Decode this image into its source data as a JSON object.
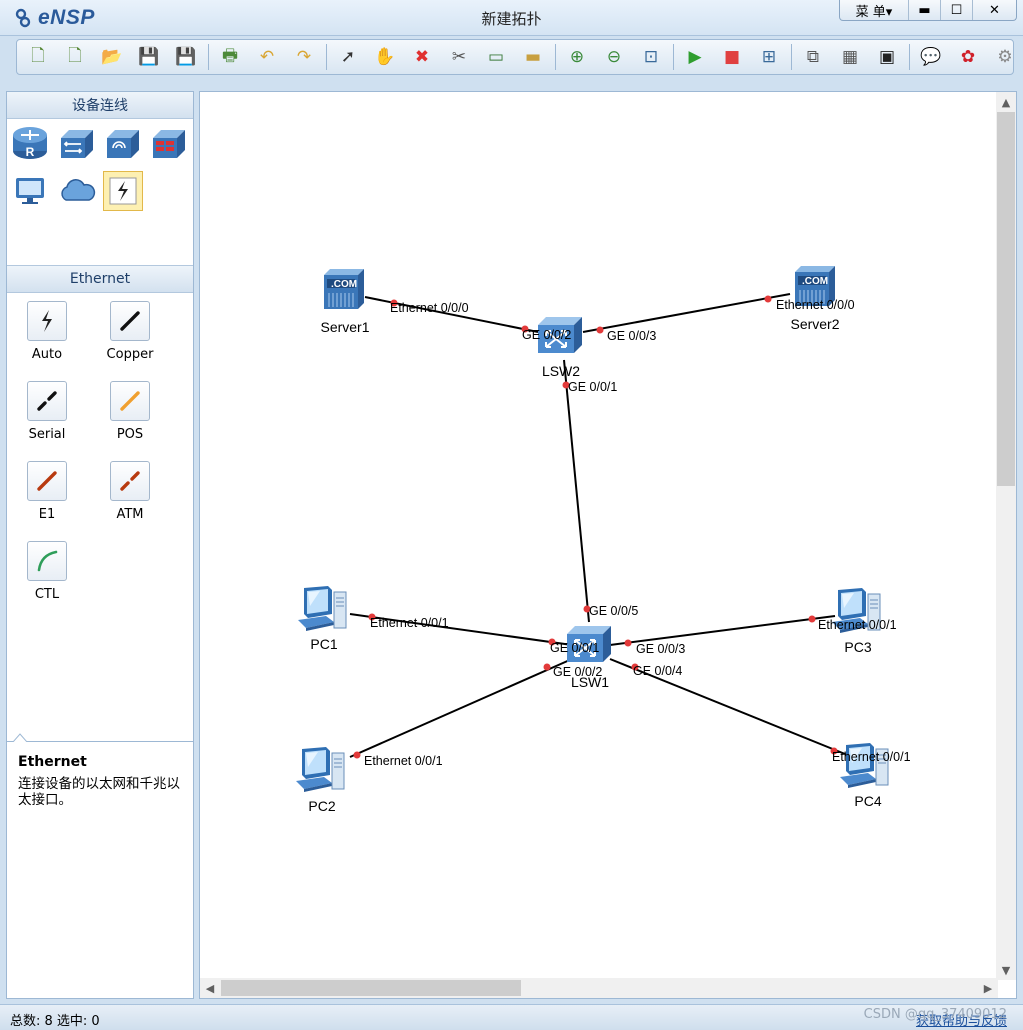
{
  "app": {
    "logo_text": "eNSP",
    "window_title": "新建拓扑",
    "menu_label": "菜 单▾",
    "minimize_glyph": "▬",
    "maximize_glyph": "☐",
    "close_glyph": "✕"
  },
  "toolbar": {
    "buttons": [
      {
        "name": "new-topology",
        "glyph": "🗋",
        "color": "#5a8a3a"
      },
      {
        "name": "new-lab",
        "glyph": "🗋",
        "color": "#5a8a3a"
      },
      {
        "name": "open",
        "glyph": "📂",
        "color": "#d9a633"
      },
      {
        "name": "save",
        "glyph": "💾",
        "color": "#c84040"
      },
      {
        "name": "save-as",
        "glyph": "💾",
        "color": "#c84040"
      },
      {
        "name": "print",
        "glyph": "🖶",
        "color": "#4d8a3a"
      },
      {
        "name": "undo",
        "glyph": "↶",
        "color": "#d9a633"
      },
      {
        "name": "redo",
        "glyph": "↷",
        "color": "#d9a633"
      },
      {
        "name": "select",
        "glyph": "➚",
        "color": "#333333"
      },
      {
        "name": "pan",
        "glyph": "✋",
        "color": "#c48a3a"
      },
      {
        "name": "delete",
        "glyph": "✖",
        "color": "#e03030"
      },
      {
        "name": "delete-link",
        "glyph": "✂",
        "color": "#555555"
      },
      {
        "name": "text",
        "glyph": "▭",
        "color": "#3a7a3a"
      },
      {
        "name": "palette",
        "glyph": "▬",
        "color": "#c8a040"
      },
      {
        "name": "zoom-in",
        "glyph": "⊕",
        "color": "#3a8a3a"
      },
      {
        "name": "zoom-out",
        "glyph": "⊖",
        "color": "#3a8a3a"
      },
      {
        "name": "fit",
        "glyph": "⊡",
        "color": "#3a6a9a"
      },
      {
        "name": "start",
        "glyph": "▶",
        "color": "#2f9e2f"
      },
      {
        "name": "stop",
        "glyph": "■",
        "color": "#e04040"
      },
      {
        "name": "capture",
        "glyph": "⊞",
        "color": "#3a6a9a"
      },
      {
        "name": "topology",
        "glyph": "⧉",
        "color": "#555555"
      },
      {
        "name": "table",
        "glyph": "▦",
        "color": "#555555"
      },
      {
        "name": "terminal",
        "glyph": "▣",
        "color": "#222222"
      },
      {
        "name": "chat",
        "glyph": "💬",
        "color": "#3a6a9a"
      },
      {
        "name": "huawei",
        "glyph": "✿",
        "color": "#d0202a"
      },
      {
        "name": "settings",
        "glyph": "⚙",
        "color": "#888888"
      },
      {
        "name": "help",
        "glyph": "?",
        "color": "#e0a020"
      }
    ]
  },
  "left_panel": {
    "devices_header": "设备连线",
    "cables_header": "Ethernet",
    "cables": [
      {
        "label": "Auto",
        "name": "auto"
      },
      {
        "label": "Copper",
        "name": "copper"
      },
      {
        "label": "Serial",
        "name": "serial"
      },
      {
        "label": "POS",
        "name": "pos"
      },
      {
        "label": "E1",
        "name": "e1"
      },
      {
        "label": "ATM",
        "name": "atm"
      },
      {
        "label": "CTL",
        "name": "ctl"
      }
    ],
    "description_title": "Ethernet",
    "description_text": "连接设备的以太网和千兆以太接口。"
  },
  "topology": {
    "nodes": {
      "server1": "Server1",
      "server2": "Server2",
      "lsw2": "LSW2",
      "lsw1": "LSW1",
      "pc1": "PC1",
      "pc2": "PC2",
      "pc3": "PC3",
      "pc4": "PC4"
    },
    "server_badge": ".COM",
    "ports": {
      "s1_eth": "Ethernet 0/0/0",
      "lsw2_ge2": "GE 0/0/2",
      "lsw2_ge3": "GE 0/0/3",
      "s2_eth": "Ethernet 0/0/0",
      "lsw2_ge1": "GE 0/0/1",
      "lsw1_ge5": "GE 0/0/5",
      "pc1_eth": "Ethernet 0/0/1",
      "lsw1_ge1": "GE 0/0/1",
      "lsw1_ge3": "GE 0/0/3",
      "pc3_eth": "Ethernet 0/0/1",
      "lsw1_ge2": "GE 0/0/2",
      "pc2_eth": "Ethernet 0/0/1",
      "lsw1_ge4": "GE 0/0/4",
      "pc4_eth": "Ethernet 0/0/1"
    }
  },
  "status_bar": {
    "count_text": "总数: 8  选中: 0",
    "help_link": "获取帮助与反馈",
    "watermark": "CSDN @qq_37409012"
  }
}
